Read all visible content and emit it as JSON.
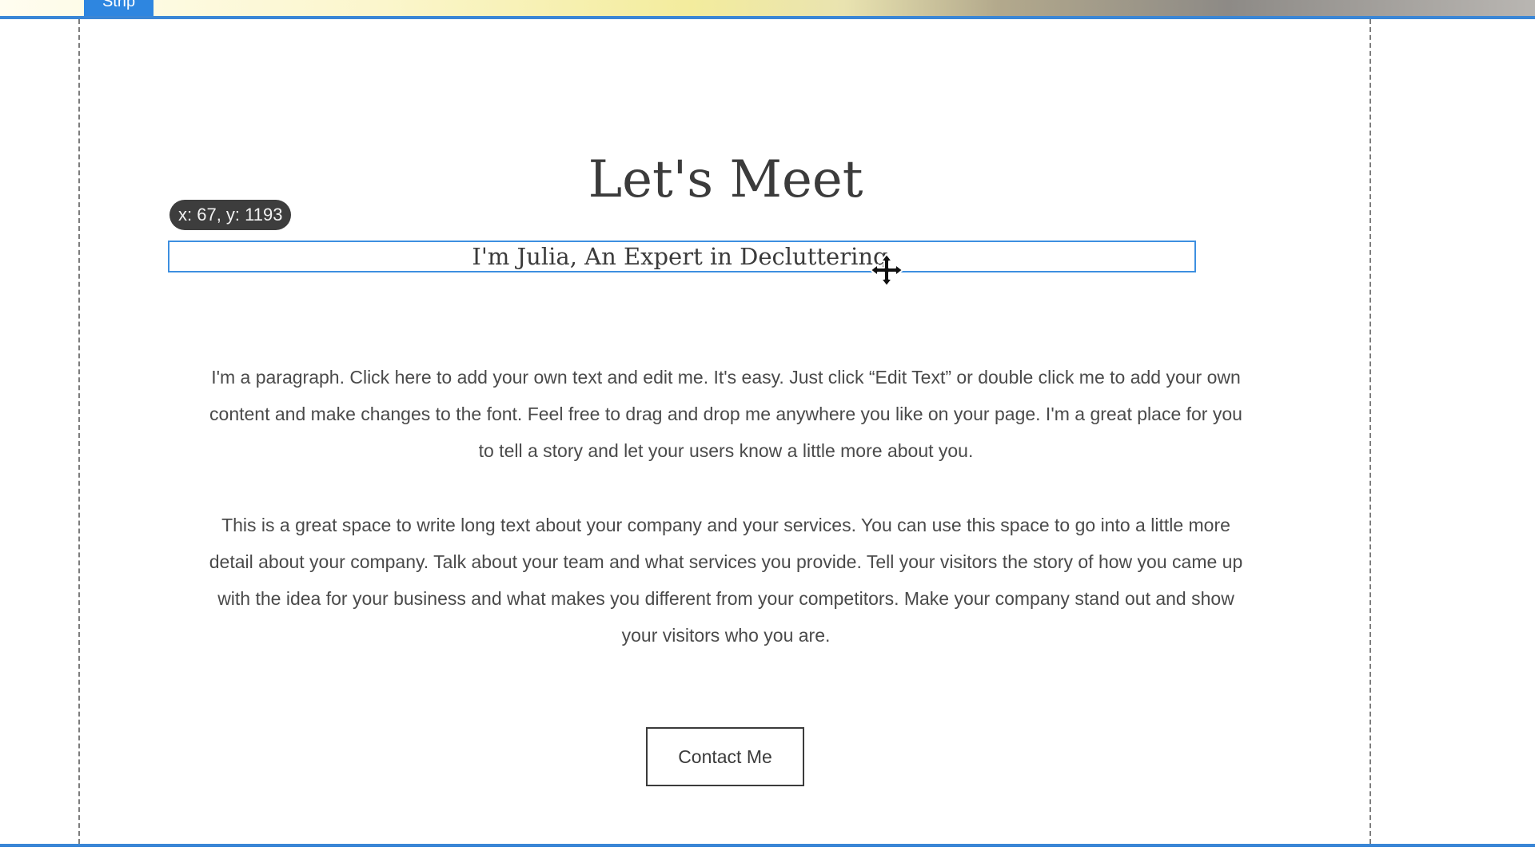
{
  "strip": {
    "tab_label": "Strip",
    "accent_color": "#3a86d6"
  },
  "section": {
    "title": "Let's Meet",
    "subtitle": "I'm Julia, An Expert in Decluttering",
    "paragraph_1": "I'm a paragraph. Click here to add your own text and edit me. It's easy. Just click “Edit Text” or double click me to add your own content and make changes to the font. Feel free to drag and drop me anywhere you like on your page. I'm a great place for you to tell a story and let your users know a little more about you.",
    "paragraph_2": "This is a great space to write long text about your company and your services. You can use this space to go into a little more detail about your company. Talk about your team and what services you provide. Tell your visitors the story of how you came up with the idea for your business and what makes you different from your competitors. Make your company stand out and show your visitors who you are.",
    "button_label": "Contact Me"
  },
  "editor": {
    "position_tooltip": "x: 67, y: 1193",
    "selection_color": "#3d8fe0",
    "cursor_icon": "move-cursor-icon"
  }
}
